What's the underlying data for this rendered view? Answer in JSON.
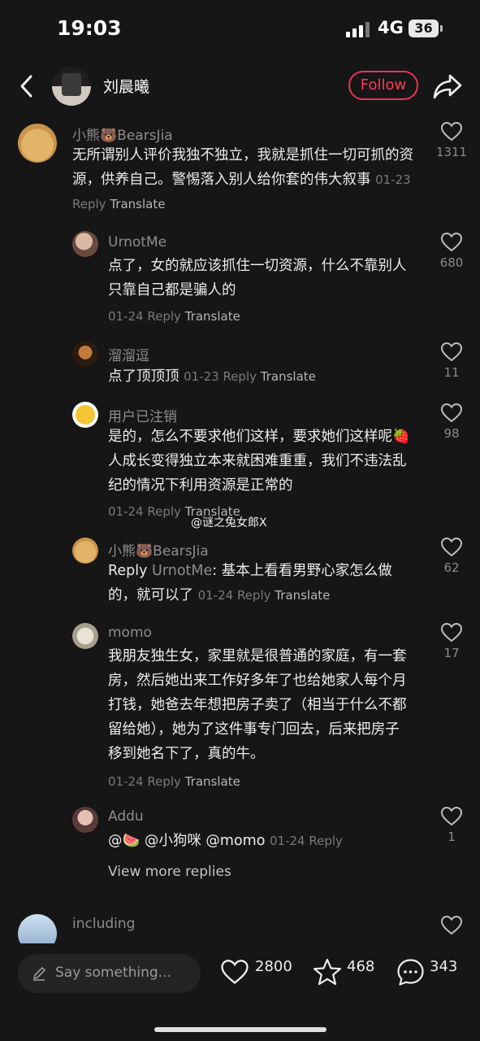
{
  "status_bar": {
    "time": "19:03",
    "network": "4G",
    "battery": "36"
  },
  "header": {
    "username": "刘晨曦",
    "follow_label": "Follow"
  },
  "comments": [
    {
      "name": "小熊🐻BearsJia",
      "text": "无所谓别人评价我独不独立，我就是抓住一切可抓的资源，供养自己。警惕落入别人给你套的伟大叙事",
      "date": "01-23",
      "reply": "Reply",
      "translate": "Translate",
      "likes": "1311"
    },
    {
      "name": "UrnotMe",
      "text": "点了，女的就应该抓住一切资源，什么不靠别人只靠自己都是骗人的",
      "date": "01-24",
      "reply": "Reply",
      "translate": "Translate",
      "likes": "680"
    },
    {
      "name": "溜溜逗",
      "text": "点了顶顶顶",
      "date": "01-23",
      "reply": "Reply",
      "translate": "Translate",
      "likes": "11"
    },
    {
      "name": "用户已注销",
      "text": "是的，怎么不要求他们这样，要求她们这样呢🍓人成长变得独立本来就困难重重，我们不违法乱纪的情况下利用资源是正常的",
      "date": "01-24",
      "reply": "Reply",
      "translate": "Translate",
      "likes": "98"
    },
    {
      "name": "小熊🐻BearsJia",
      "reply_prefix": "Reply",
      "reply_to": "UrnotMe",
      "text": ": 基本上看看男野心家怎么做的，就可以了",
      "date": "01-24",
      "reply": "Reply",
      "translate": "Translate",
      "likes": "62"
    },
    {
      "name": "momo",
      "text": "我朋友独生女，家里就是很普通的家庭，有一套房，然后她出来工作好多年了也给她家人每个月打钱，她爸去年想把房子卖了（相当于什么不都留给她），她为了这件事专门回去，后来把房子移到她名下了，真的牛。",
      "date": "01-24",
      "reply": "Reply",
      "translate": "Translate",
      "likes": "17"
    },
    {
      "name": "Addu",
      "text": "@🍉 @小狗咪 @momo",
      "date": "01-24",
      "reply": "Reply",
      "likes": "1"
    },
    {
      "name": "including"
    }
  ],
  "view_more": "View more replies",
  "watermark": "@谜之兔女郎X",
  "bottom_bar": {
    "placeholder": "Say something...",
    "likes": "2800",
    "favorites": "468",
    "comments": "343"
  }
}
